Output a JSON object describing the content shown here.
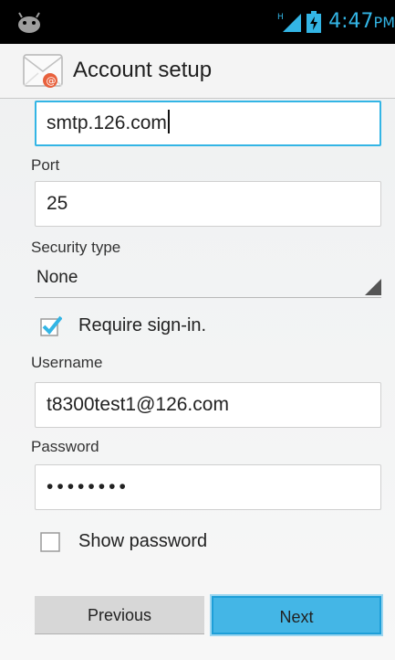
{
  "status_bar": {
    "time": "4:47",
    "ampm": "PM",
    "network_type": "H",
    "notification_icon": "android-icon",
    "signal_icon": "signal-icon",
    "battery_icon": "battery-charging-icon",
    "accent_color": "#33b5e5"
  },
  "action_bar": {
    "title": "Account setup",
    "icon": "email-app-icon"
  },
  "form": {
    "server": {
      "value": "smtp.126.com"
    },
    "port": {
      "label": "Port",
      "value": "25"
    },
    "security_type": {
      "label": "Security type",
      "selected": "None"
    },
    "require_signin": {
      "label": "Require sign-in.",
      "checked": true
    },
    "username": {
      "label": "Username",
      "value": "t8300test1@126.com"
    },
    "password": {
      "label": "Password",
      "masked_value": "••••••••"
    },
    "show_password": {
      "label": "Show password",
      "checked": false
    }
  },
  "buttons": {
    "previous": "Previous",
    "next": "Next"
  },
  "colors": {
    "accent": "#33b5e5",
    "next_button": "#44b6e6",
    "previous_button": "#d7d7d7"
  }
}
